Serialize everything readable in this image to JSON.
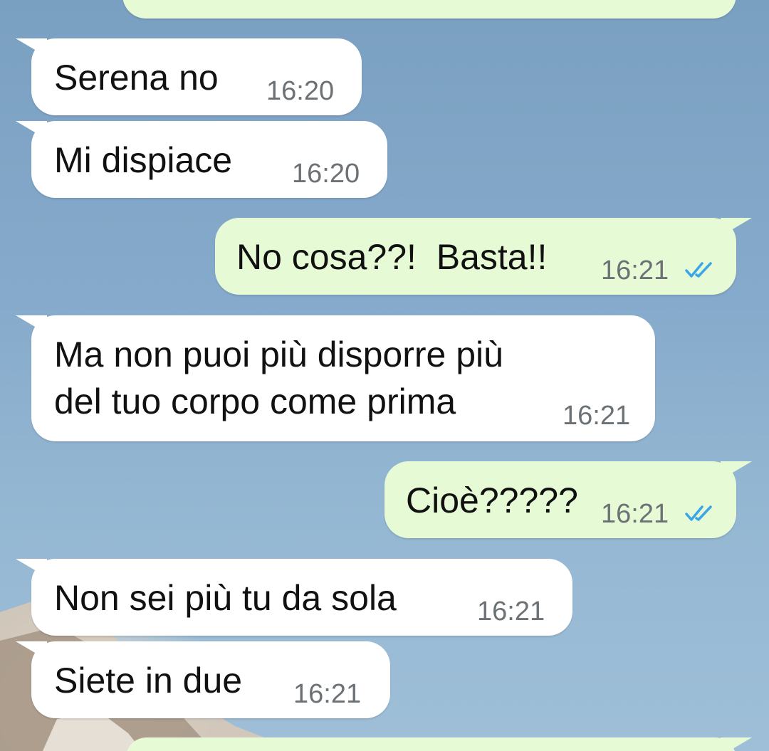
{
  "colors": {
    "incoming_bubble": "#ffffff",
    "outgoing_bubble": "#e6fbd5",
    "time_text": "#6b7175",
    "read_ticks": "#3aa6e8"
  },
  "messages": [
    {
      "direction": "in",
      "text": "Serena no",
      "time": "16:20"
    },
    {
      "direction": "in",
      "text": "Mi dispiace",
      "time": "16:20"
    },
    {
      "direction": "out",
      "text": "No cosa??!  Basta!!",
      "time": "16:21",
      "status": "read-double-check-icon"
    },
    {
      "direction": "in",
      "text_lines": [
        "Ma non puoi più disporre più",
        "del tuo corpo come prima"
      ],
      "time": "16:21"
    },
    {
      "direction": "out",
      "text": "Cioè?????",
      "time": "16:21",
      "status": "read-double-check-icon"
    },
    {
      "direction": "in",
      "text": "Non sei più tu da sola",
      "time": "16:21"
    },
    {
      "direction": "in",
      "text": "Siete in due",
      "time": "16:21"
    }
  ]
}
